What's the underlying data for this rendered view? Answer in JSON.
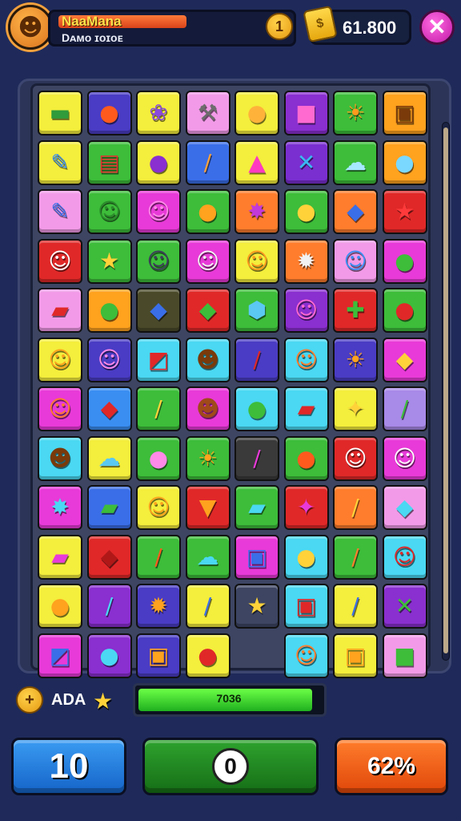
{
  "header": {
    "player_name": "NaaMana",
    "player_subtitle": "Dᴀᴍᴏ ɪᴏɪᴏᴇ",
    "level": "1",
    "coins": "61.800",
    "close_symbol": "✕"
  },
  "board": {
    "columns": 8,
    "rows": 12,
    "tiles": [
      {
        "r": 0,
        "c": 0,
        "color": "#f4ee3c",
        "glyph": "▬",
        "gcolor": "#2f9b3a"
      },
      {
        "r": 0,
        "c": 1,
        "color": "#4a3cc4",
        "glyph": "●",
        "gcolor": "#ff5a1e"
      },
      {
        "r": 0,
        "c": 2,
        "color": "#f4ee3c",
        "glyph": "❀",
        "gcolor": "#8a4adf"
      },
      {
        "r": 0,
        "c": 3,
        "color": "#f29ae8",
        "glyph": "⚒",
        "gcolor": "#6d6d6d"
      },
      {
        "r": 0,
        "c": 4,
        "color": "#f4ee3c",
        "glyph": "●",
        "gcolor": "#ffb23a"
      },
      {
        "r": 0,
        "c": 5,
        "color": "#8a2fd0",
        "glyph": "■",
        "gcolor": "#ff6ad0"
      },
      {
        "r": 0,
        "c": 6,
        "color": "#3dbd3a",
        "glyph": "☀",
        "gcolor": "#ff9a1e"
      },
      {
        "r": 0,
        "c": 7,
        "color": "#ffa21e",
        "glyph": "▣",
        "gcolor": "#7a3a0a"
      },
      {
        "r": 1,
        "c": 0,
        "color": "#f4ee3c",
        "glyph": "✎",
        "gcolor": "#3a8ef2"
      },
      {
        "r": 1,
        "c": 1,
        "color": "#3dbd3a",
        "glyph": "▤",
        "gcolor": "#e03030"
      },
      {
        "r": 1,
        "c": 2,
        "color": "#f4ee3c",
        "glyph": "●",
        "gcolor": "#8a2fd0"
      },
      {
        "r": 1,
        "c": 3,
        "color": "#3a6ee8",
        "glyph": "/",
        "gcolor": "#ffa23a"
      },
      {
        "r": 1,
        "c": 4,
        "color": "#f4ee3c",
        "glyph": "▲",
        "gcolor": "#ff3ac0"
      },
      {
        "r": 1,
        "c": 5,
        "color": "#7a2fd0",
        "glyph": "✕",
        "gcolor": "#3ab8f2"
      },
      {
        "r": 1,
        "c": 6,
        "color": "#3dbd3a",
        "glyph": "☁",
        "gcolor": "#a6e8ff"
      },
      {
        "r": 1,
        "c": 7,
        "color": "#ffa21e",
        "glyph": "●",
        "gcolor": "#7ad8ff"
      },
      {
        "r": 2,
        "c": 0,
        "color": "#f29ae8",
        "glyph": "✎",
        "gcolor": "#3a6ee8"
      },
      {
        "r": 2,
        "c": 1,
        "color": "#3dbd3a",
        "glyph": "☺",
        "gcolor": "#2a8a2a"
      },
      {
        "r": 2,
        "c": 2,
        "color": "#e83ad8",
        "glyph": "☺",
        "gcolor": "#ff8ae8"
      },
      {
        "r": 2,
        "c": 3,
        "color": "#3dbd3a",
        "glyph": "●",
        "gcolor": "#ffa21e"
      },
      {
        "r": 2,
        "c": 4,
        "color": "#ff7d2c",
        "glyph": "✸",
        "gcolor": "#c23ad8"
      },
      {
        "r": 2,
        "c": 5,
        "color": "#3dbd3a",
        "glyph": "●",
        "gcolor": "#ffd23a"
      },
      {
        "r": 2,
        "c": 6,
        "color": "#ff7d2c",
        "glyph": "◆",
        "gcolor": "#3a6ee8"
      },
      {
        "r": 2,
        "c": 7,
        "color": "#e02828",
        "glyph": "★",
        "gcolor": "#ff3a3a"
      },
      {
        "r": 3,
        "c": 0,
        "color": "#e02828",
        "glyph": "☺",
        "gcolor": "#ffffff"
      },
      {
        "r": 3,
        "c": 1,
        "color": "#3dbd3a",
        "glyph": "★",
        "gcolor": "#ffd23a"
      },
      {
        "r": 3,
        "c": 2,
        "color": "#3dbd3a",
        "glyph": "☺",
        "gcolor": "#3d3d5a"
      },
      {
        "r": 3,
        "c": 3,
        "color": "#e83ad8",
        "glyph": "☺",
        "gcolor": "#f2f2f2"
      },
      {
        "r": 3,
        "c": 4,
        "color": "#f4ee3c",
        "glyph": "☺",
        "gcolor": "#ff9a1e"
      },
      {
        "r": 3,
        "c": 5,
        "color": "#ff7d2c",
        "glyph": "✹",
        "gcolor": "#f2f2f2"
      },
      {
        "r": 3,
        "c": 6,
        "color": "#f29ae8",
        "glyph": "☺",
        "gcolor": "#3a8ef2"
      },
      {
        "r": 3,
        "c": 7,
        "color": "#e83ad8",
        "glyph": "●",
        "gcolor": "#3dbd3a"
      },
      {
        "r": 4,
        "c": 0,
        "color": "#f29ae8",
        "glyph": "▰",
        "gcolor": "#e02828"
      },
      {
        "r": 4,
        "c": 1,
        "color": "#ffa21e",
        "glyph": "●",
        "gcolor": "#3dbd3a"
      },
      {
        "r": 4,
        "c": 2,
        "color": "#4a4a2a",
        "glyph": "◆",
        "gcolor": "#3a6ee8"
      },
      {
        "r": 4,
        "c": 3,
        "color": "#e02828",
        "glyph": "◆",
        "gcolor": "#3dbd3a"
      },
      {
        "r": 4,
        "c": 4,
        "color": "#3dbd3a",
        "glyph": "⬢",
        "gcolor": "#5ac8f2"
      },
      {
        "r": 4,
        "c": 5,
        "color": "#8a2fd0",
        "glyph": "☺",
        "gcolor": "#ff6ad0"
      },
      {
        "r": 4,
        "c": 6,
        "color": "#e02828",
        "glyph": "✚",
        "gcolor": "#3dbd3a"
      },
      {
        "r": 4,
        "c": 7,
        "color": "#3dbd3a",
        "glyph": "●",
        "gcolor": "#e02828"
      },
      {
        "r": 5,
        "c": 0,
        "color": "#f4ee3c",
        "glyph": "☺",
        "gcolor": "#ffa21e"
      },
      {
        "r": 5,
        "c": 1,
        "color": "#4a3cc4",
        "glyph": "☺",
        "gcolor": "#ff8ae8"
      },
      {
        "r": 5,
        "c": 2,
        "color": "#4ad8f2",
        "glyph": "◩",
        "gcolor": "#e02828"
      },
      {
        "r": 5,
        "c": 3,
        "color": "#4ad8f2",
        "glyph": "☻",
        "gcolor": "#7a3a0a"
      },
      {
        "r": 5,
        "c": 4,
        "color": "#4a3cc4",
        "glyph": "/",
        "gcolor": "#e02828"
      },
      {
        "r": 5,
        "c": 5,
        "color": "#4ad8f2",
        "glyph": "☺",
        "gcolor": "#ff7d2c"
      },
      {
        "r": 5,
        "c": 6,
        "color": "#4a3cc4",
        "glyph": "☀",
        "gcolor": "#ffa21e"
      },
      {
        "r": 5,
        "c": 7,
        "color": "#e83ad8",
        "glyph": "◆",
        "gcolor": "#ffd23a"
      },
      {
        "r": 6,
        "c": 0,
        "color": "#e83ad8",
        "glyph": "☺",
        "gcolor": "#ff7d2c"
      },
      {
        "r": 6,
        "c": 1,
        "color": "#3a8ef2",
        "glyph": "◆",
        "gcolor": "#e02828"
      },
      {
        "r": 6,
        "c": 2,
        "color": "#3dbd3a",
        "glyph": "/",
        "gcolor": "#ffd23a"
      },
      {
        "r": 6,
        "c": 3,
        "color": "#e83ad8",
        "glyph": "☻",
        "gcolor": "#a04a1a"
      },
      {
        "r": 6,
        "c": 4,
        "color": "#4ad8f2",
        "glyph": "●",
        "gcolor": "#3dbd3a"
      },
      {
        "r": 6,
        "c": 5,
        "color": "#4ad8f2",
        "glyph": "▰",
        "gcolor": "#e02828"
      },
      {
        "r": 6,
        "c": 6,
        "color": "#f4ee3c",
        "glyph": "✦",
        "gcolor": "#ffd23a"
      },
      {
        "r": 6,
        "c": 7,
        "color": "#a88ae8",
        "glyph": "/",
        "gcolor": "#3dbd3a"
      },
      {
        "r": 7,
        "c": 0,
        "color": "#4ad8f2",
        "glyph": "☻",
        "gcolor": "#7a3a0a"
      },
      {
        "r": 7,
        "c": 1,
        "color": "#f4ee3c",
        "glyph": "☁",
        "gcolor": "#5ac8f2"
      },
      {
        "r": 7,
        "c": 2,
        "color": "#3dbd3a",
        "glyph": "●",
        "gcolor": "#ff8ae8"
      },
      {
        "r": 7,
        "c": 3,
        "color": "#3dbd3a",
        "glyph": "☀",
        "gcolor": "#ffa21e"
      },
      {
        "r": 7,
        "c": 4,
        "color": "#3a3a3a",
        "glyph": "/",
        "gcolor": "#e83ad8"
      },
      {
        "r": 7,
        "c": 5,
        "color": "#3dbd3a",
        "glyph": "●",
        "gcolor": "#ff5a1e"
      },
      {
        "r": 7,
        "c": 6,
        "color": "#e02828",
        "glyph": "☺",
        "gcolor": "#ffffff"
      },
      {
        "r": 7,
        "c": 7,
        "color": "#e83ad8",
        "glyph": "☺",
        "gcolor": "#ffffff"
      },
      {
        "r": 8,
        "c": 0,
        "color": "#e83ad8",
        "glyph": "✸",
        "gcolor": "#4ad8f2"
      },
      {
        "r": 8,
        "c": 1,
        "color": "#3a6ee8",
        "glyph": "▰",
        "gcolor": "#3dbd3a"
      },
      {
        "r": 8,
        "c": 2,
        "color": "#f4ee3c",
        "glyph": "☺",
        "gcolor": "#ffa21e"
      },
      {
        "r": 8,
        "c": 3,
        "color": "#e02828",
        "glyph": "▼",
        "gcolor": "#ffa21e"
      },
      {
        "r": 8,
        "c": 4,
        "color": "#3dbd3a",
        "glyph": "▰",
        "gcolor": "#4ad8f2"
      },
      {
        "r": 8,
        "c": 5,
        "color": "#e02828",
        "glyph": "✦",
        "gcolor": "#e83ad8"
      },
      {
        "r": 8,
        "c": 6,
        "color": "#ff7d2c",
        "glyph": "/",
        "gcolor": "#ffd23a"
      },
      {
        "r": 8,
        "c": 7,
        "color": "#f29ae8",
        "glyph": "◆",
        "gcolor": "#4ad8f2"
      },
      {
        "r": 9,
        "c": 0,
        "color": "#f4ee3c",
        "glyph": "▰",
        "gcolor": "#e83ad8"
      },
      {
        "r": 9,
        "c": 1,
        "color": "#e02828",
        "glyph": "◆",
        "gcolor": "#b01818"
      },
      {
        "r": 9,
        "c": 2,
        "color": "#3dbd3a",
        "glyph": "/",
        "gcolor": "#ff5a1e"
      },
      {
        "r": 9,
        "c": 3,
        "color": "#3dbd3a",
        "glyph": "☁",
        "gcolor": "#4ad8f2"
      },
      {
        "r": 9,
        "c": 4,
        "color": "#e83ad8",
        "glyph": "▣",
        "gcolor": "#3a6ee8"
      },
      {
        "r": 9,
        "c": 5,
        "color": "#4ad8f2",
        "glyph": "●",
        "gcolor": "#ffd23a"
      },
      {
        "r": 9,
        "c": 6,
        "color": "#3dbd3a",
        "glyph": "/",
        "gcolor": "#ff7d2c"
      },
      {
        "r": 9,
        "c": 7,
        "color": "#4ad8f2",
        "glyph": "☺",
        "gcolor": "#e02828"
      },
      {
        "r": 10,
        "c": 0,
        "color": "#f4ee3c",
        "glyph": "●",
        "gcolor": "#ffa21e"
      },
      {
        "r": 10,
        "c": 1,
        "color": "#8a2fd0",
        "glyph": "/",
        "gcolor": "#4ad8f2"
      },
      {
        "r": 10,
        "c": 2,
        "color": "#4a3cc4",
        "glyph": "✹",
        "gcolor": "#ffa21e"
      },
      {
        "r": 10,
        "c": 3,
        "color": "#f4ee3c",
        "glyph": "/",
        "gcolor": "#3a6ee8"
      },
      {
        "r": 10,
        "c": 4,
        "color": "#3d4563",
        "glyph": "★",
        "gcolor": "#ffd23a"
      },
      {
        "r": 10,
        "c": 5,
        "color": "#4ad8f2",
        "glyph": "▣",
        "gcolor": "#e02828"
      },
      {
        "r": 10,
        "c": 6,
        "color": "#f4ee3c",
        "glyph": "/",
        "gcolor": "#3a6ee8"
      },
      {
        "r": 10,
        "c": 7,
        "color": "#8a2fd0",
        "glyph": "✕",
        "gcolor": "#3dbd3a"
      },
      {
        "r": 11,
        "c": 0,
        "color": "#e83ad8",
        "glyph": "◩",
        "gcolor": "#3a6ee8"
      },
      {
        "r": 11,
        "c": 1,
        "color": "#8a2fd0",
        "glyph": "●",
        "gcolor": "#4ad8f2"
      },
      {
        "r": 11,
        "c": 2,
        "color": "#4a3cc4",
        "glyph": "▣",
        "gcolor": "#ffa21e"
      },
      {
        "r": 11,
        "c": 3,
        "color": "#f4ee3c",
        "glyph": "●",
        "gcolor": "#e02828"
      },
      {
        "r": 11,
        "c": 5,
        "color": "#4ad8f2",
        "glyph": "☺",
        "gcolor": "#ff7d2c"
      },
      {
        "r": 11,
        "c": 6,
        "color": "#f4ee3c",
        "glyph": "▣",
        "gcolor": "#ffa21e"
      },
      {
        "r": 11,
        "c": 7,
        "color": "#f29ae8",
        "glyph": "■",
        "gcolor": "#3dbd3a"
      }
    ]
  },
  "stats": {
    "bolt_symbol": "+",
    "label": "ADA",
    "progress_text": "7036",
    "progress_fraction": 0.95
  },
  "buttons": {
    "left_value": "10",
    "center_value": "0",
    "right_value": "62%"
  }
}
